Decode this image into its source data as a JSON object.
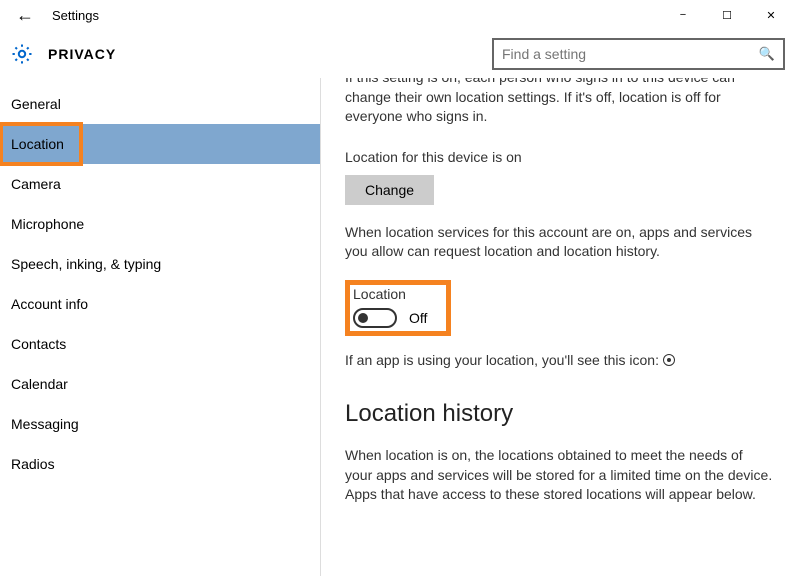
{
  "window": {
    "title": "Settings"
  },
  "header": {
    "page_title": "PRIVACY",
    "search_placeholder": "Find a setting"
  },
  "sidebar": {
    "items": [
      {
        "label": "General"
      },
      {
        "label": "Location"
      },
      {
        "label": "Camera"
      },
      {
        "label": "Microphone"
      },
      {
        "label": "Speech, inking, & typing"
      },
      {
        "label": "Account info"
      },
      {
        "label": "Contacts"
      },
      {
        "label": "Calendar"
      },
      {
        "label": "Messaging"
      },
      {
        "label": "Radios"
      }
    ]
  },
  "content": {
    "intro_cut": "If this setting is on, each person who signs in to this device can change their own location settings. If it's off, location is off for everyone who signs in.",
    "device_status": "Location for this device is on",
    "change_btn": "Change",
    "account_desc": "When location services for this account are on, apps and services you allow can request location and location history.",
    "toggle_label": "Location",
    "toggle_state": "Off",
    "app_icon_note": "If an app is using your location, you'll see this icon:",
    "history_heading": "Location history",
    "history_desc": "When location is on, the locations obtained to meet the needs of your apps and services will be stored for a limited time on the device. Apps that have access to these stored locations will appear below."
  }
}
